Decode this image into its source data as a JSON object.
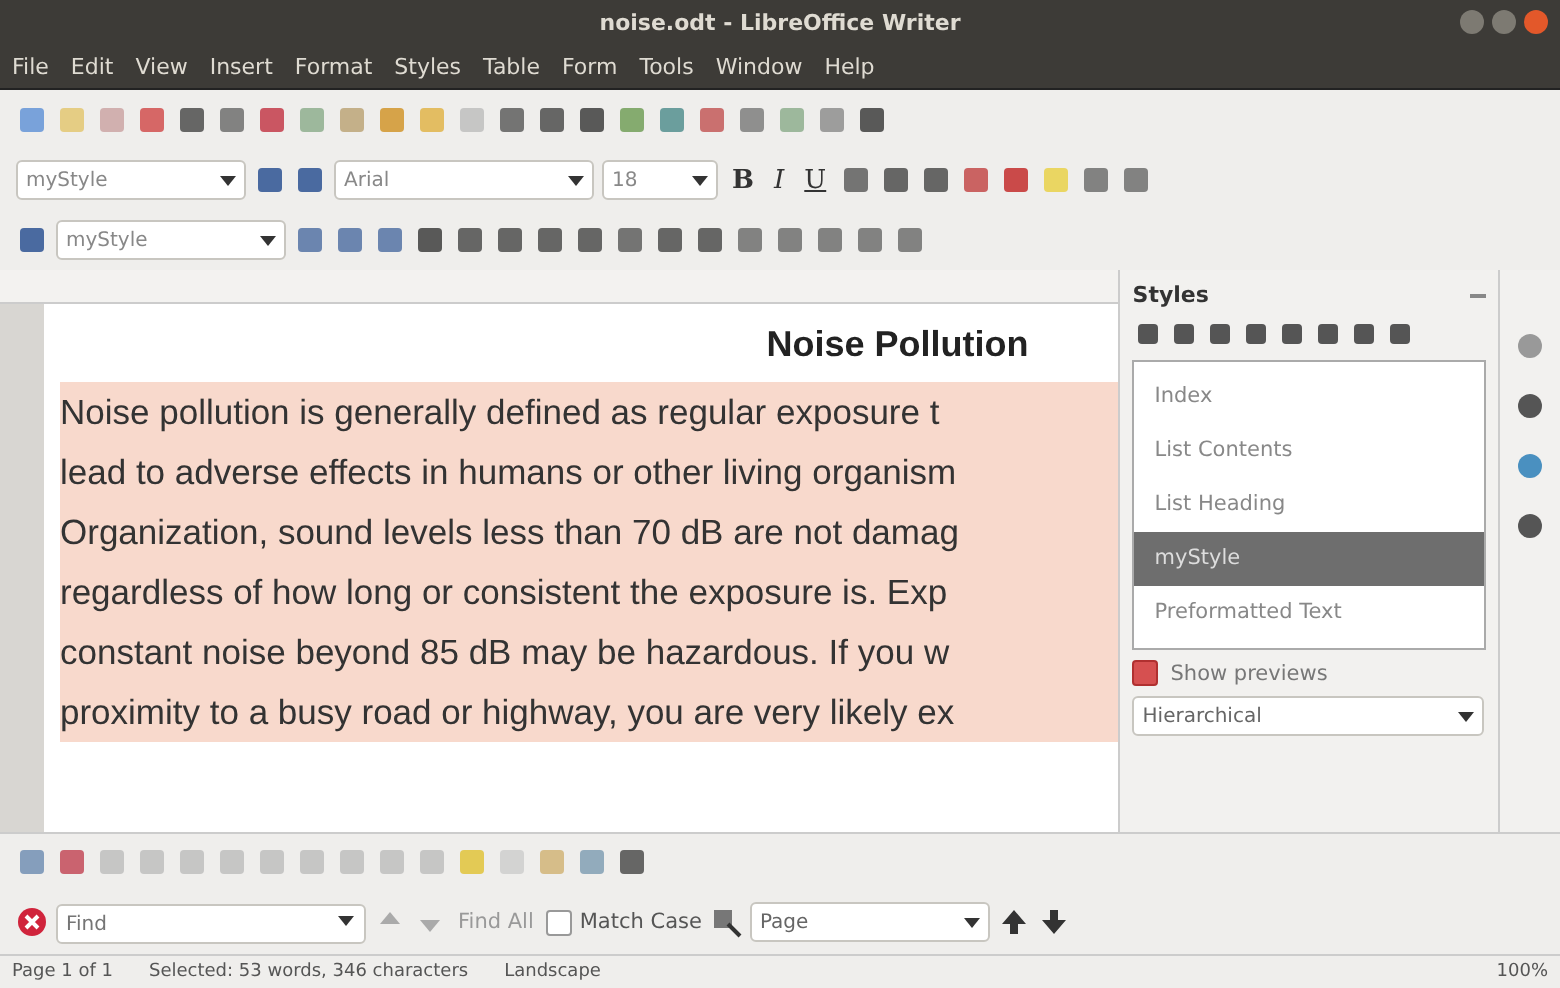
{
  "window": {
    "title": "noise.odt - LibreOffice Writer"
  },
  "menu": [
    "File",
    "Edit",
    "View",
    "Insert",
    "Format",
    "Styles",
    "Table",
    "Form",
    "Tools",
    "Window",
    "Help"
  ],
  "formatting_toolbar": {
    "paragraph_style": "myStyle",
    "font_name": "Arial",
    "font_size": "18",
    "text_buttons": [
      "B",
      "I",
      "U"
    ]
  },
  "style_toolbar": {
    "paragraph_style": "myStyle"
  },
  "document": {
    "heading": "Noise Pollution",
    "highlighted": true,
    "lines": [
      "Noise pollution is generally defined as regular exposure t",
      "lead to adverse effects in humans or other living organism",
      "Organization, sound levels less than 70 dB are not damag",
      "regardless of how long or consistent the exposure is. Exp",
      "constant noise beyond 85 dB may be hazardous. If you w",
      "proximity to a busy road or highway, you are very likely ex"
    ]
  },
  "styles_panel": {
    "title": "Styles",
    "items": [
      {
        "label": "Index",
        "selected": false
      },
      {
        "label": "List Contents",
        "selected": false
      },
      {
        "label": "List Heading",
        "selected": false
      },
      {
        "label": "myStyle",
        "selected": true
      },
      {
        "label": "Preformatted Text",
        "selected": false
      }
    ],
    "show_previews": {
      "label": "Show previews",
      "checked": true
    },
    "filter": "Hierarchical"
  },
  "find_bar": {
    "placeholder": "Find",
    "find_all": "Find All",
    "match_case": {
      "label": "Match Case",
      "checked": false
    },
    "scope": "Page"
  },
  "status_bar": [
    "Page 1 of 1",
    "Selected: 53 words, 346 characters",
    "Landscape",
    "100%"
  ]
}
